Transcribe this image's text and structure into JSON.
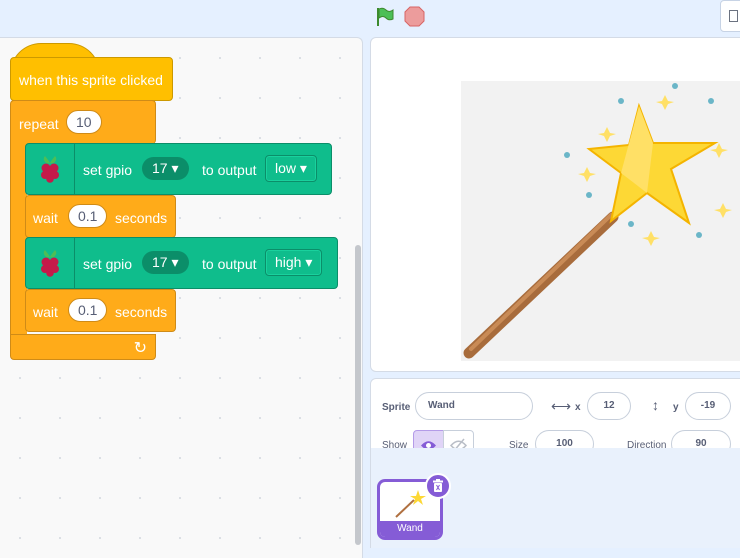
{
  "toolbar": {
    "flag_icon": "green-flag-icon",
    "stop_icon": "stop-icon"
  },
  "script": {
    "event_label": "when this sprite clicked",
    "repeat_label": "repeat",
    "repeat_count": "10",
    "blocks": [
      {
        "set_label": "set gpio",
        "pin": "17",
        "to_label": "to output",
        "mode": "low"
      },
      {
        "wait_label": "wait",
        "seconds_value": "0.1",
        "seconds_label": "seconds"
      },
      {
        "set_label": "set gpio",
        "pin": "17",
        "to_label": "to output",
        "mode": "high"
      },
      {
        "wait_label": "wait",
        "seconds_value": "0.1",
        "seconds_label": "seconds"
      }
    ]
  },
  "sprite_info": {
    "sprite_label": "Sprite",
    "sprite_name": "Wand",
    "x_label": "x",
    "x_value": "12",
    "y_label": "y",
    "y_value": "-19",
    "show_label": "Show",
    "size_label": "Size",
    "size_value": "100",
    "direction_label": "Direction",
    "direction_value": "90"
  },
  "sprites": [
    {
      "name": "Wand",
      "selected": true
    }
  ],
  "colors": {
    "events": "#ffbf00",
    "control": "#ffab19",
    "extension": "#0fbd8c",
    "accent": "#855cd6"
  }
}
